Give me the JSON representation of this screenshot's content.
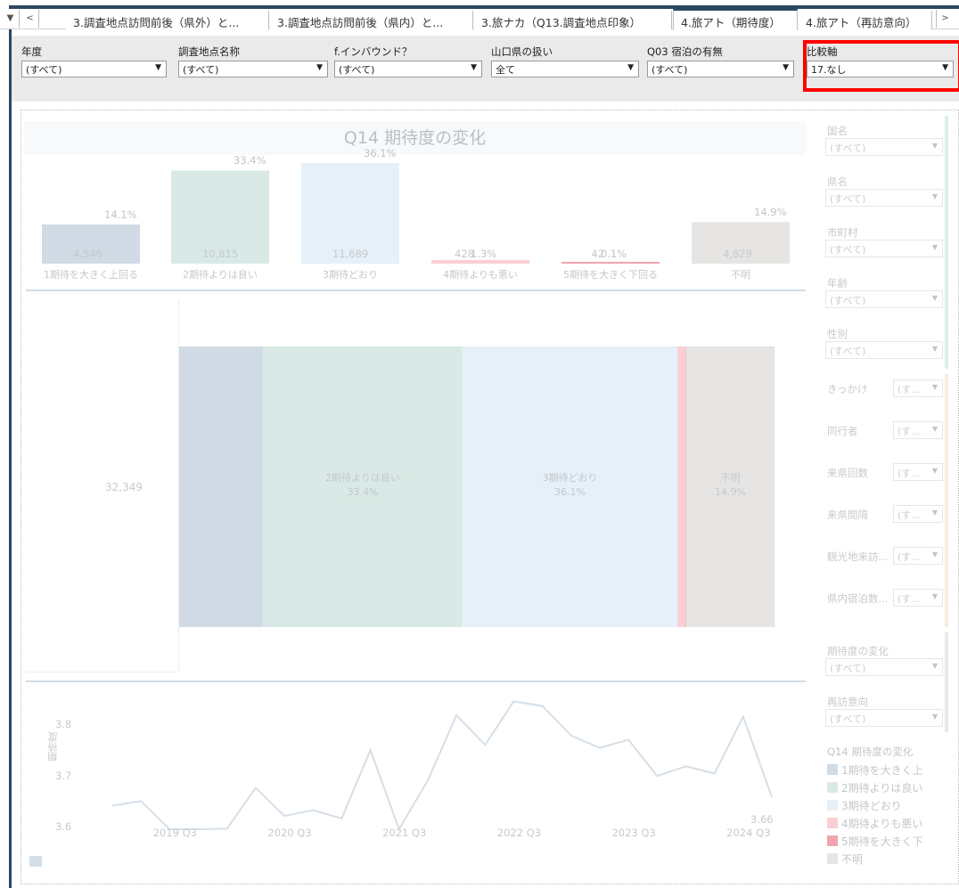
{
  "tabs": {
    "items": [
      "3.調査地点訪問前後（県外）と...",
      "3.調査地点訪問前後（県内）と...",
      "3.旅ナカ（Q13.調査地点印象）",
      "4.旅アト（期待度）",
      "4.旅アト（再訪意向）"
    ],
    "active_index": 3,
    "ctrl_down": "▼",
    "ctrl_prev": "<",
    "ctrl_next": ">"
  },
  "filters": [
    {
      "label": "年度",
      "value": "(すべて)"
    },
    {
      "label": "調査地点名称",
      "value": "(すべて)"
    },
    {
      "label": "f.インバウンド？",
      "value": "(すべて)"
    },
    {
      "label": "山口県の扱い",
      "value": "全て"
    },
    {
      "label": "Q03 宿泊の有無",
      "value": "(すべて)"
    },
    {
      "label": "比較軸",
      "value": "17.なし"
    }
  ],
  "dashboard": {
    "title": "Q14 期待度の変化",
    "total": "32,349"
  },
  "chart_data": [
    {
      "type": "bar",
      "title": "Q14 期待度の変化",
      "categories": [
        "1期待を大きく上回る",
        "2期待よりは良い",
        "3期待どおり",
        "4期待よりも悪い",
        "5期待を大きく下回る",
        "不明"
      ],
      "values": [
        4546,
        10815,
        11689,
        428,
        42,
        4829
      ],
      "value_labels": [
        "4,546",
        "10,815",
        "11,689",
        "428",
        "42",
        "4,829"
      ],
      "percents": [
        14.1,
        33.4,
        36.1,
        1.3,
        0.1,
        14.9
      ],
      "percent_labels": [
        "14.1%",
        "33.4%",
        "36.1%",
        "1.3%",
        "0.1%",
        "14.9%"
      ],
      "colors": [
        "#d0dbe5",
        "#d9e9e5",
        "#e6f0f8",
        "#f8cfd3",
        "#f0a5ad",
        "#e6e5e3"
      ]
    },
    {
      "type": "bar",
      "segments": [
        {
          "category": "1期待を大きく上回る",
          "share": 14.1,
          "label": ""
        },
        {
          "category": "2期待よりは良い",
          "share": 33.4,
          "label": "2期待よりは良い\n33.4%"
        },
        {
          "category": "3期待どおり",
          "share": 36.1,
          "label": "3期待どおり\n36.1%"
        },
        {
          "category": "4期待よりも悪い",
          "share": 1.3,
          "label": ""
        },
        {
          "category": "5期待を大きく下回る",
          "share": 0.1,
          "label": ""
        },
        {
          "category": "不明",
          "share": 14.9,
          "label": "不明\n14.9%"
        }
      ]
    },
    {
      "type": "line",
      "ylabel": "期待度",
      "yticks": [
        "3.6",
        "3.7",
        "3.8"
      ],
      "ylim": [
        3.59,
        3.86
      ],
      "xticks": [
        "2019 Q3",
        "2020 Q3",
        "2021 Q3",
        "2022 Q3",
        "2023 Q3",
        "2024 Q3"
      ],
      "xtick_index": [
        2,
        6,
        10,
        14,
        18,
        22
      ],
      "values": [
        3.643,
        3.652,
        3.597,
        3.597,
        3.598,
        3.678,
        3.623,
        3.634,
        3.618,
        3.752,
        3.597,
        3.692,
        3.82,
        3.762,
        3.847,
        3.838,
        3.78,
        3.756,
        3.772,
        3.701,
        3.72,
        3.706,
        3.817,
        3.66
      ],
      "last_label": "3.66"
    }
  ],
  "right_panel": {
    "group1": [
      {
        "label": "国名",
        "value": "(すべて)"
      },
      {
        "label": "県名",
        "value": "(すべて)"
      },
      {
        "label": "市町村",
        "value": "(すべて)"
      },
      {
        "label": "年齢",
        "value": "(すべて)"
      },
      {
        "label": "性別",
        "value": "(すべて)"
      }
    ],
    "group2": [
      {
        "label": "きっかけ",
        "value": "(す..."
      },
      {
        "label": "同行者",
        "value": "(す..."
      },
      {
        "label": "来県回数",
        "value": "(す..."
      },
      {
        "label": "来県間隔",
        "value": "(す..."
      },
      {
        "label": "観光地来訪...",
        "value": "(す..."
      },
      {
        "label": "県内宿泊数...",
        "value": "(す..."
      }
    ],
    "group3": [
      {
        "label": "期待度の変化",
        "value": "(すべて)"
      },
      {
        "label": "再訪意向",
        "value": "(すべて)"
      }
    ],
    "caret": "▼",
    "group_colors": [
      "#dcefe9",
      "#f7ecdb",
      "#ece6f0"
    ]
  },
  "legend": {
    "title": "Q14 期待度の変化",
    "items": [
      "1期待を大きく上",
      "2期待よりは良い",
      "3期待どおり",
      "4期待よりも悪い",
      "5期待を大きく下",
      "不明"
    ]
  }
}
